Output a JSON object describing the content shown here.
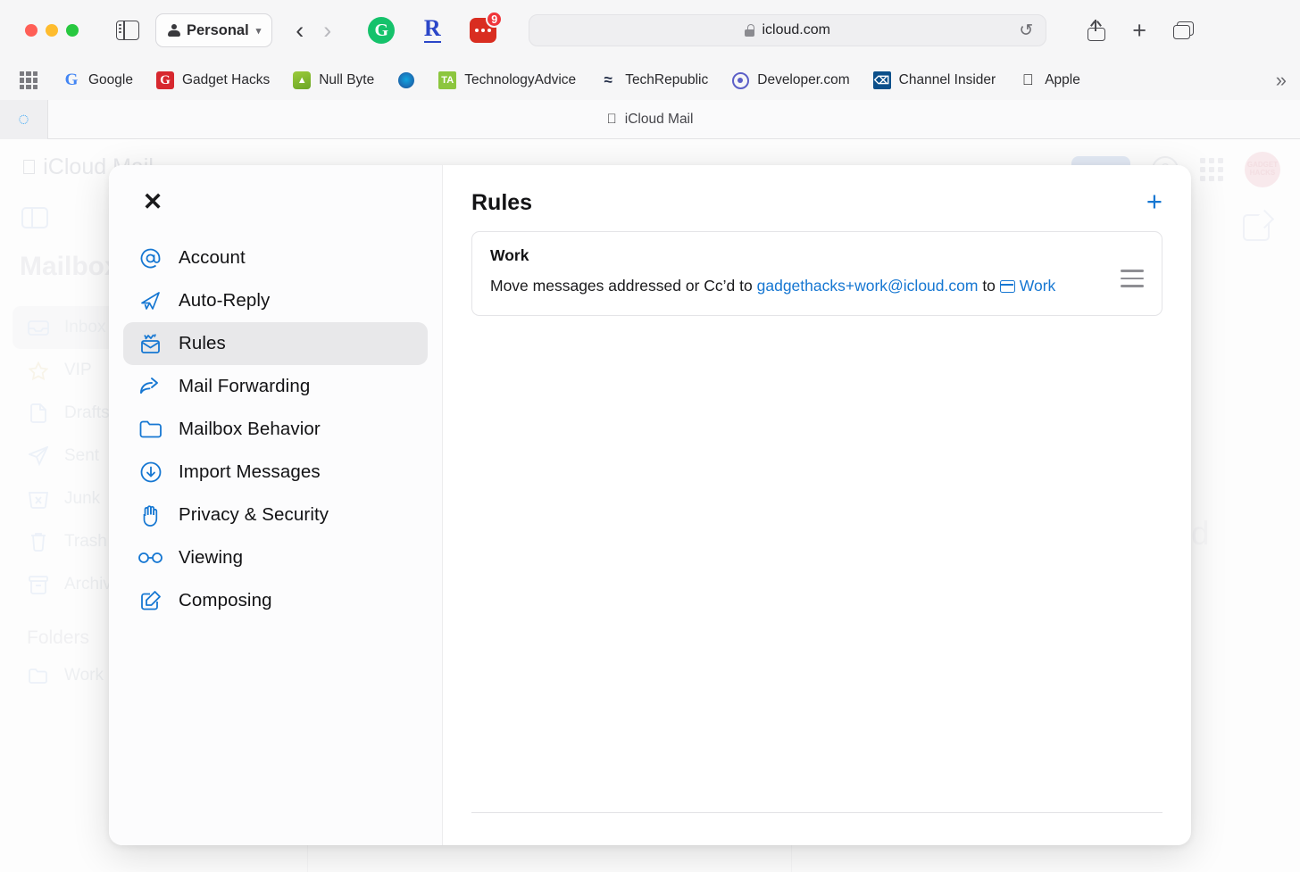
{
  "browser": {
    "profile_label": "Personal",
    "url": "icloud.com",
    "extensions": [
      {
        "name": "grammarly-extension-icon",
        "glyph": "G"
      },
      {
        "name": "readwise-extension-icon",
        "glyph": "R"
      },
      {
        "name": "password-extension-icon",
        "badge": "9"
      }
    ],
    "bookmarks": [
      {
        "label": "Google",
        "icon": "google-favicon"
      },
      {
        "label": "Gadget Hacks",
        "icon": "gadget-hacks-favicon"
      },
      {
        "label": "Null Byte",
        "icon": "null-byte-favicon"
      },
      {
        "label": "",
        "icon": "wonderhowto-favicon"
      },
      {
        "label": "TechnologyAdvice",
        "icon": "technologyadvice-favicon"
      },
      {
        "label": "TechRepublic",
        "icon": "techrepublic-favicon"
      },
      {
        "label": "Developer.com",
        "icon": "developer-com-favicon"
      },
      {
        "label": "Channel Insider",
        "icon": "channel-insider-favicon"
      },
      {
        "label": "Apple",
        "icon": "apple-favicon"
      }
    ],
    "overflow_glyph": "»",
    "tab_title": "iCloud Mail"
  },
  "mail_background": {
    "brand": "iCloud Mail",
    "sidebar_title": "Mailboxes",
    "mailboxes": [
      {
        "label": "Inbox",
        "icon": "inbox-icon",
        "selected": true
      },
      {
        "label": "VIP",
        "icon": "star-icon",
        "selected": false
      },
      {
        "label": "Drafts",
        "icon": "drafts-icon",
        "selected": false
      },
      {
        "label": "Sent",
        "icon": "sent-icon",
        "selected": false
      },
      {
        "label": "Junk",
        "icon": "junk-icon",
        "selected": false
      },
      {
        "label": "Trash",
        "icon": "trash-icon",
        "selected": false
      },
      {
        "label": "Archive",
        "icon": "archive-icon",
        "selected": false
      }
    ],
    "folders_header": "Folders",
    "folders": [
      {
        "label": "Work",
        "icon": "folder-icon"
      }
    ],
    "empty_state": "No Message Selected",
    "avatar_initials": "GADGET HACKS"
  },
  "modal": {
    "close_label": "✕",
    "sidebar_items": [
      {
        "label": "Account",
        "icon": "at-sign-icon",
        "active": false
      },
      {
        "label": "Auto-Reply",
        "icon": "paper-plane-icon",
        "active": false
      },
      {
        "label": "Rules",
        "icon": "rules-envelope-icon",
        "active": true
      },
      {
        "label": "Mail Forwarding",
        "icon": "forward-arrow-icon",
        "active": false
      },
      {
        "label": "Mailbox Behavior",
        "icon": "folder-icon",
        "active": false
      },
      {
        "label": "Import Messages",
        "icon": "download-circle-icon",
        "active": false
      },
      {
        "label": "Privacy & Security",
        "icon": "hand-raised-icon",
        "active": false
      },
      {
        "label": "Viewing",
        "icon": "glasses-icon",
        "active": false
      },
      {
        "label": "Composing",
        "icon": "compose-pencil-icon",
        "active": false
      }
    ],
    "panel": {
      "title": "Rules",
      "add_label": "+",
      "rules": [
        {
          "name": "Work",
          "desc_prefix": "Move messages addressed or Cc’d to ",
          "address": "gadgethacks+work@icloud.com",
          "desc_middle": " to ",
          "folder": "Work"
        }
      ]
    }
  },
  "colors": {
    "accent_blue": "#1677d2",
    "text_primary": "#131315",
    "selected_row": "#e8e8ea"
  }
}
